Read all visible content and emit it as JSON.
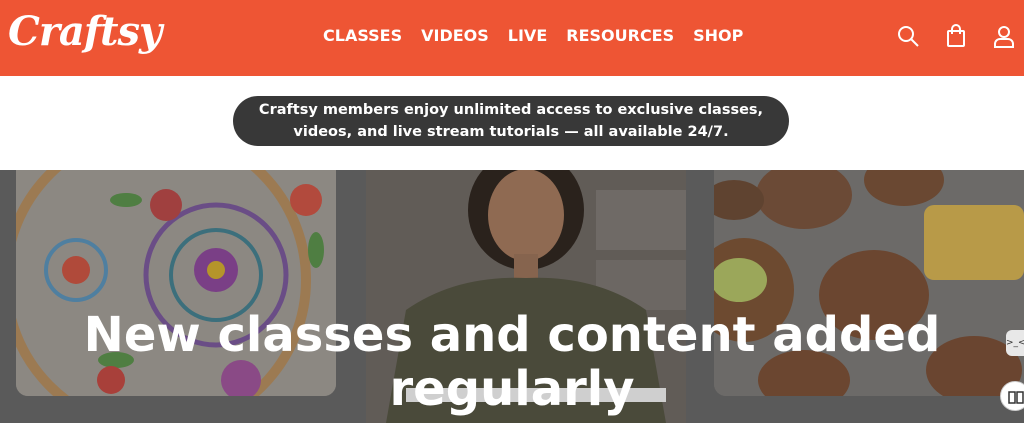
{
  "brand": {
    "name": "Craftsy"
  },
  "nav": {
    "items": [
      {
        "label": "CLASSES"
      },
      {
        "label": "VIDEOS"
      },
      {
        "label": "LIVE"
      },
      {
        "label": "RESOURCES"
      },
      {
        "label": "SHOP"
      }
    ]
  },
  "header_icons": [
    "search-icon",
    "shopping-bag-icon",
    "user-icon"
  ],
  "announcement": {
    "line1": "Craftsy members enjoy unlimited access to exclusive classes,",
    "line2": "videos, and live stream tutorials — all available 24/7."
  },
  "hero": {
    "headline_line1": "New classes and content added",
    "headline_line2": "regularly"
  },
  "side_widget": {
    "label": ">_<"
  },
  "colors": {
    "brand_orange": "#ee5534",
    "pill_bg": "#383838",
    "text_on_dark": "#ffffff"
  }
}
